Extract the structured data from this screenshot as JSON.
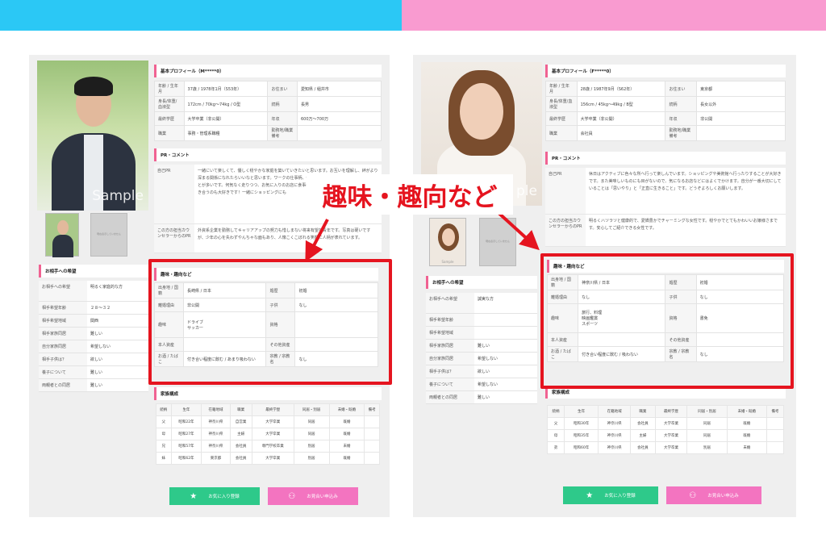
{
  "callout": {
    "text": "趣味・趣向など"
  },
  "left": {
    "photo_label": "Sample",
    "profile": {
      "title": "基本プロフィール（M*****0）",
      "rows": [
        [
          "年齢 / 生年月",
          "37歳 / 1978年1月（S53年）",
          "お住まい",
          "愛知県 / 稲井市"
        ],
        [
          "身長/体重/血液型",
          "172cm / 70kg〜74kg / O型",
          "続柄",
          "長男"
        ],
        [
          "最終学歴",
          "大学卒業（非公開）",
          "年収",
          "600万〜700万"
        ],
        [
          "職業",
          "事務・管理系職種",
          "勤務地/職業備考",
          ""
        ]
      ]
    },
    "pr": {
      "title": "PR・コメント",
      "self_label": "自己PR",
      "self_text": "一緒にいて楽しくて、優しく穏やかな家庭を築いていきたいと思います。お互いを理解し、絆がより深まる関係になれたらいいなと思います。ワークの仕事柄、休日には車やバイクでお出かけすることが多いです。何気なく走りつつ、お気に入りのお店に食事にいったりもします。休日は行くのも付き合うのも大好きです！一緒にショッピングにも",
      "counselor_label": "この方の担当カウンセラーからのPR",
      "counselor_text": "外資系企業を勤務してキャリアアップの努力も惜しまない将来有望な青年です。写真は硬いですが、少年の心を失わずやんちゃな面もあり、人懐こくこぼれる笑顔に人柄が表れています。"
    },
    "thumb_placeholder": "現在表示していません",
    "hobby": {
      "title": "趣味・趣向など",
      "rows": [
        [
          "出身地 / 国籍",
          "長崎県 / 日本",
          "婚歴",
          "初婚"
        ],
        [
          "離婚理由",
          "非公開",
          "子供",
          "なし"
        ],
        [
          "趣味",
          "ドライブ\nサッカー",
          "資格",
          ""
        ],
        [
          "本人資産",
          "",
          "その他資産",
          ""
        ],
        [
          "お酒 / たばこ",
          "付き合い程度に飲む / あまり吸わない",
          "宗教 / 宗教名",
          "なし"
        ]
      ]
    },
    "wishes": {
      "title": "お相手への希望",
      "rows": [
        [
          "お相手への希望",
          "明るく家庭的な方"
        ],
        [
          "相手希望年齢",
          "２８〜３２"
        ],
        [
          "相手希望地域",
          "関西"
        ],
        [
          "相手家族同居",
          "難しい"
        ],
        [
          "自分家族同居",
          "希望しない"
        ],
        [
          "相手子供は？",
          "欲しい"
        ],
        [
          "養子について",
          "難しい"
        ],
        [
          "両親者との同居",
          "難しい"
        ]
      ]
    },
    "family": {
      "title": "家族構成",
      "headers": [
        "続柄",
        "生年",
        "在籍地域",
        "職業",
        "最終学歴",
        "同居・別居",
        "未婚・既婚",
        "備考"
      ],
      "rows": [
        [
          "父",
          "昭和22年",
          "神奈川県",
          "自営業",
          "大学卒業",
          "同居",
          "既婚",
          ""
        ],
        [
          "母",
          "昭和27年",
          "神奈川県",
          "主婦",
          "大学卒業",
          "同居",
          "既婚",
          ""
        ],
        [
          "兄",
          "昭和57年",
          "神奈川県",
          "会社員",
          "専門学校卒業",
          "別居",
          "未婚",
          ""
        ],
        [
          "妹",
          "昭和62年",
          "東京都",
          "会社員",
          "大学卒業",
          "別居",
          "既婚",
          ""
        ]
      ]
    },
    "btn_fav": "お気に入り登録",
    "btn_apply": "お見合い申込み"
  },
  "right": {
    "photo_label": "ple",
    "thumb_label": "Sample",
    "profile": {
      "title": "基本プロフィール（F*****0）",
      "rows": [
        [
          "年齢 / 生年月",
          "28歳 / 1987年9月（S62年）",
          "お住まい",
          "東京都"
        ],
        [
          "身長/体重/血液型",
          "156cm / 45kg〜49kg / B型",
          "続柄",
          "長女以外"
        ],
        [
          "最終学歴",
          "大学卒業（非公開）",
          "年収",
          "非公開"
        ],
        [
          "職業",
          "会社員",
          "勤務地/職業備考",
          ""
        ]
      ]
    },
    "pr": {
      "title": "PR・コメント",
      "self_label": "自己PR",
      "self_text": "休日はアクティブに色々な所へ行って楽しんでいます。ショッピングや美術館へ行ったりすることが大好きです。また美味しいものにも目がないので、気になるお店などにはよくでかけます。自分が一番大切にしていることは「思いやり」と「正直に生きること」です。どうぞよろしくお願いします。",
      "counselor_label": "この方の担当カウンセラーからのPR",
      "counselor_text": "明るくハツラツと健康的で、愛嬌豊かでチャーミングな女性です。穏やかでとてもかわいいお嬢様さまです。安心してご紹介できる女性です。"
    },
    "thumb_placeholder": "現在表示していません",
    "hobby": {
      "title": "趣味・趣向など",
      "rows": [
        [
          "出身地 / 国籍",
          "神奈川県 / 日本",
          "婚歴",
          "初婚"
        ],
        [
          "離婚理由",
          "なし",
          "子供",
          "なし"
        ],
        [
          "趣味",
          "旅行、料理\n映画鑑賞\nスポーツ",
          "資格",
          "書免"
        ],
        [
          "本人資産",
          "",
          "その他資産",
          ""
        ],
        [
          "お酒 / たばこ",
          "付き合い程度に飲む / 吸わない",
          "宗教 / 宗教名",
          "なし"
        ]
      ]
    },
    "wishes": {
      "title": "お相手への希望",
      "rows": [
        [
          "お相手への希望",
          "誠実な方"
        ],
        [
          "相手希望年齢",
          ""
        ],
        [
          "相手希望地域",
          ""
        ],
        [
          "相手家族同居",
          "難しい"
        ],
        [
          "自分家族同居",
          "希望しない"
        ],
        [
          "相手子供は？",
          "欲しい"
        ],
        [
          "養子について",
          "希望しない"
        ],
        [
          "両親者との同居",
          "難しい"
        ]
      ]
    },
    "family": {
      "title": "家族構成",
      "headers": [
        "続柄",
        "生年",
        "在籍地域",
        "職業",
        "最終学歴",
        "同居・別居",
        "未婚・既婚",
        "備考"
      ],
      "rows": [
        [
          "父",
          "昭和30年",
          "神奈川県",
          "会社員",
          "大学卒業",
          "同居",
          "既婚",
          ""
        ],
        [
          "母",
          "昭和35年",
          "神奈川県",
          "主婦",
          "大学卒業",
          "同居",
          "既婚",
          ""
        ],
        [
          "弟",
          "昭和60年",
          "神奈川県",
          "会社員",
          "大学卒業",
          "別居",
          "未婚",
          ""
        ]
      ]
    },
    "btn_fav": "お気に入り登録",
    "btn_apply": "お見合い申込み"
  },
  "colors": {
    "accent_red": "#e5141f",
    "green": "#2ec98a",
    "pink": "#f374c0",
    "cyan": "#2bc8f5"
  }
}
